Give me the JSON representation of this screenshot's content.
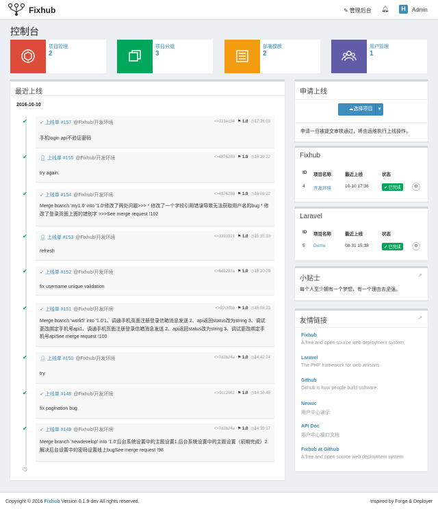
{
  "app": {
    "brand": "Fixhub",
    "admin_link": "管理后台",
    "avatar_letter": "H",
    "user": "Admin"
  },
  "page_title": "控制台",
  "stats": [
    {
      "label": "项目管理",
      "value": "2",
      "color": "#dd4b39",
      "icon": "cube-icon"
    },
    {
      "label": "项目分组",
      "value": "3",
      "color": "#00a65a",
      "icon": "copy-icon"
    },
    {
      "label": "部署模板",
      "value": "2",
      "color": "#f39c12",
      "icon": "list-icon"
    },
    {
      "label": "用户管理",
      "value": "1",
      "color": "#605ca8",
      "icon": "users-icon"
    }
  ],
  "recent": {
    "title": "最近上线",
    "date": "2016-10-10",
    "items": [
      {
        "title": "上线单 #157",
        "env": "@Fixhub/开发环境",
        "commit": "221ec34",
        "version": "1.0",
        "time": "17:36:03",
        "body": "手机login api不验证密码",
        "icon": "paper-plane-icon"
      },
      {
        "title": "上线单 #155",
        "env": "@Fixhub/开发环境",
        "commit": "4876280",
        "version": "1.0",
        "time": "16:29:22",
        "body": "try again.",
        "icon": "user-icon"
      },
      {
        "title": "上线单 #154",
        "env": "@Fixhub/开发环境",
        "commit": "4876280",
        "version": "1.0",
        "time": "16:06:22",
        "body": "Merge branch 'my1.0' into '1.0'修改了两处问题>>> * 修改了一个字段引用错误导致无法获取用户名的bug * 修改了登录页面上面的错别字 >>>See merge request !102",
        "icon": "paper-plane-icon"
      },
      {
        "title": "上线单 #153",
        "env": "@Fixhub/开发环境",
        "commit": "3393921",
        "version": "1.0",
        "time": "15:35:10",
        "body": "refresh",
        "icon": "user-icon"
      },
      {
        "title": "上线单 #152",
        "env": "@Fixhub/开发环境",
        "commit": "6d3292a",
        "version": "1.0",
        "time": "15:20:09",
        "body": "fix username unique validation",
        "icon": "paper-plane-icon"
      },
      {
        "title": "上线单 #151",
        "env": "@Fixhub/开发环境",
        "commit": "92c6fbb",
        "version": "1.0",
        "time": "15:08:23",
        "body": "Merge branch 'work5' into '1.0'1、调通手机页面注册登录信箱消息发送 2、api返回status改为string 3、调试更改绑定手机号api1、调通手机页面注册登录信箱消息发送 2、api返回status改为string 3、调试更改绑定手机号apiSee merge request !100",
        "icon": "paper-plane-icon"
      },
      {
        "title": "上线单 #150",
        "env": "@Fixhub/开发环境",
        "commit": "7d2b24a",
        "version": "1.0",
        "time": "14:42:24",
        "body": "try",
        "icon": "user-icon"
      },
      {
        "title": "上线单 #148",
        "env": "@Fixhub/开发环境",
        "commit": "9cc2062",
        "version": "1.0",
        "time": "14:36:45",
        "body": "fix pagination bug",
        "icon": "paper-plane-icon"
      },
      {
        "title": "上线单 #149",
        "env": "@Fixhub/开发环境",
        "commit": "7d2b24a",
        "version": "1.0",
        "time": "14:35:17",
        "body": "Merge branch 'newdevelop' into '1.0'后台系统设置中的主题设置1.后台系统设置中的主题设置（初期完成）2.解决后台设置中的密码设置线上bugSee merge request !98",
        "icon": "paper-plane-icon"
      }
    ]
  },
  "apply": {
    "title": "申请上线",
    "button": "选择项目",
    "note": "申请一旦被提交审核通过，将由运维执行上线操作。"
  },
  "table_headers": [
    "ID",
    "项目名称",
    "最近上线",
    "状态"
  ],
  "fixhub": {
    "title": "Fixhub",
    "row": {
      "id": "4",
      "name": "开发环境",
      "last": "10-10 17:36",
      "status": "已完成"
    }
  },
  "laravel": {
    "title": "Laravel",
    "row": {
      "id": "5",
      "name": "Demo",
      "last": "08-31 15:38",
      "status": "已完成"
    }
  },
  "tips": {
    "title": "小贴士",
    "text": "每个人至少拥有一个梦想，有一个理由去坚强。"
  },
  "links": {
    "title": "友情链接",
    "items": [
      {
        "name": "Fixhub",
        "desc": "A free and open-source web deployment system."
      },
      {
        "name": "Laravel",
        "desc": "The PHP framework for web artisans"
      },
      {
        "name": "Github",
        "desc": "Github is how people build software."
      },
      {
        "name": "Newuc",
        "desc": "用户中心演示"
      },
      {
        "name": "API Doc",
        "desc": "用户中心接口文档"
      },
      {
        "name": "Fixhub at Github",
        "desc": "A free and open source web deployment system"
      }
    ]
  },
  "footer": {
    "copyright": "Copyright © 2016",
    "brand": "Fixhub",
    "version": "Version 0.1.9-dev All rights reserved.",
    "right": "Inspired by Forge & Deployer"
  }
}
